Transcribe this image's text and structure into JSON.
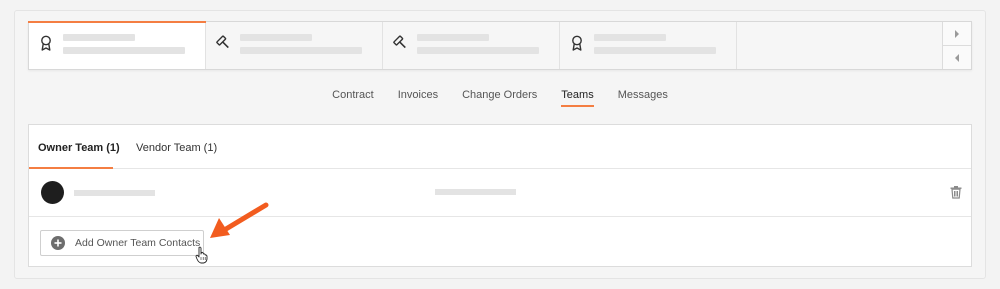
{
  "tabs": [
    {
      "label": "Contract"
    },
    {
      "label": "Invoices"
    },
    {
      "label": "Change Orders"
    },
    {
      "label": "Teams"
    },
    {
      "label": "Messages"
    }
  ],
  "active_tab": "Teams",
  "team_tabs": [
    {
      "label": "Owner Team (1)"
    },
    {
      "label": "Vendor Team (1)"
    }
  ],
  "active_team_tab": "Owner Team (1)",
  "add_button": {
    "label": "Add Owner Team Contacts"
  },
  "cards": [
    {
      "icon": "award-icon"
    },
    {
      "icon": "gavel-icon"
    },
    {
      "icon": "gavel-icon"
    },
    {
      "icon": "award-icon"
    }
  ],
  "colors": {
    "accent": "#f47e42",
    "avatar": "#1e1e1e"
  }
}
